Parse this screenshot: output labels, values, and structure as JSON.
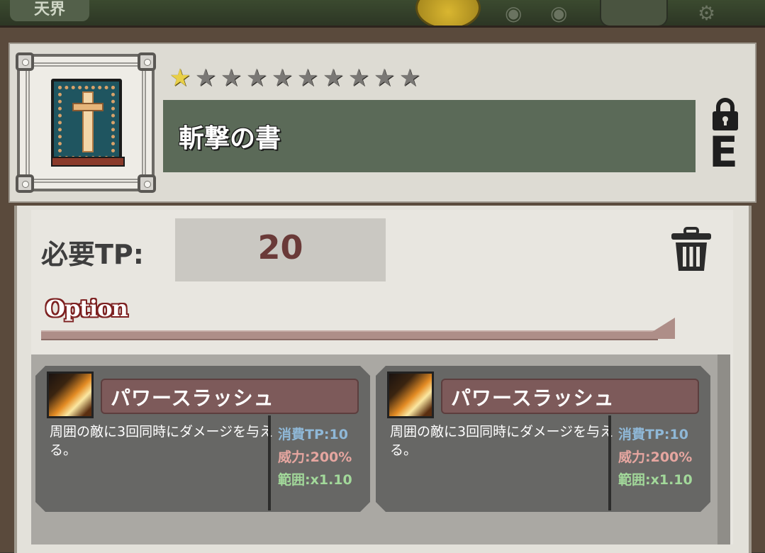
{
  "hud": {
    "area_tab": "天界"
  },
  "item": {
    "name": "斬撃の書",
    "rank": "E",
    "rarity_filled": 1,
    "rarity_total": 10,
    "locked": true,
    "icon": "spellbook-sword-icon"
  },
  "tp": {
    "label": "必要TP:",
    "value": "20"
  },
  "option": {
    "title": "Option"
  },
  "skills": [
    {
      "name": "パワースラッシュ",
      "description": "周囲の敵に3回同時にダメージを与える。",
      "cost": "消費TP:10",
      "power": "威力:200%",
      "range": "範囲:x1.10",
      "icon": "slash-skill-icon"
    },
    {
      "name": "パワースラッシュ",
      "description": "周囲の敵に3回同時にダメージを与える。",
      "cost": "消費TP:10",
      "power": "威力:200%",
      "range": "範囲:x1.10",
      "icon": "slash-skill-icon"
    }
  ],
  "colors": {
    "star_filled": "#e8cf47",
    "star_empty": "#7a7875",
    "name_box": "#5b6a58",
    "tp_value": "#6a3a38",
    "option_outline": "#7d2121",
    "stat_cost": "#8fb8d7",
    "stat_power": "#e6a6a0",
    "stat_range": "#a2d89a"
  }
}
